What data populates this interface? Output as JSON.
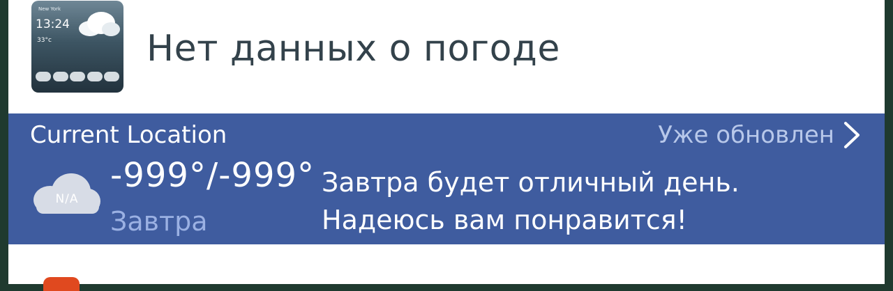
{
  "header": {
    "title": "Нет данных о погоде",
    "app_icon": {
      "city": "New York",
      "time": "13:24",
      "temp": "33°c"
    }
  },
  "banner": {
    "location": "Current Location",
    "updated": "Уже обновлен",
    "weather_icon_label": "N/A",
    "temperature": "-999°/-999°",
    "day": "Завтра",
    "message_line1": "Завтра будет отличный день.",
    "message_line2": "Надеюсь вам понравится!"
  },
  "colors": {
    "banner": "#3f5c9f",
    "title_text": "#33424b",
    "muted_text": "#b8c8ea",
    "frame": "#1f3a2f",
    "accent_app": "#e0491f"
  },
  "icons": [
    "weather-app-icon",
    "chevron-right-icon",
    "cloud-na-icon",
    "next-app-icon"
  ]
}
